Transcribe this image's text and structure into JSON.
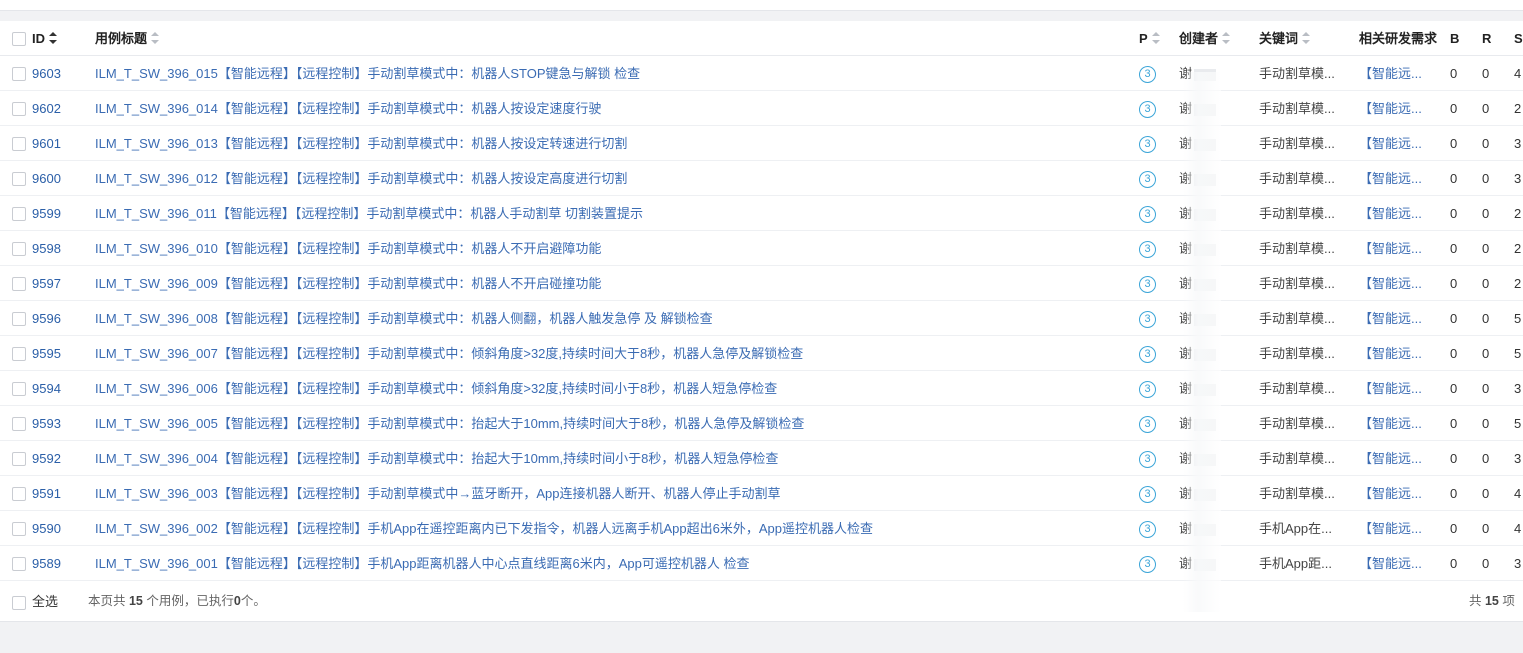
{
  "header": {
    "id": "ID",
    "title": "用例标题",
    "priority": "P",
    "creator": "创建者",
    "keyword": "关键词",
    "related": "相关研发需求",
    "b": "B",
    "r": "R",
    "s": "S"
  },
  "rows": [
    {
      "id": "9603",
      "title": "ILM_T_SW_396_015【智能远程】【远程控制】手动割草模式中：机器人STOP键急与解锁 检查",
      "p": "3",
      "creator": "谢",
      "keyword": "手动割草模...",
      "req": "【智能远...",
      "b": "0",
      "r": "0",
      "s": "4"
    },
    {
      "id": "9602",
      "title": "ILM_T_SW_396_014【智能远程】【远程控制】手动割草模式中：机器人按设定速度行驶",
      "p": "3",
      "creator": "谢",
      "keyword": "手动割草模...",
      "req": "【智能远...",
      "b": "0",
      "r": "0",
      "s": "2"
    },
    {
      "id": "9601",
      "title": "ILM_T_SW_396_013【智能远程】【远程控制】手动割草模式中：机器人按设定转速进行切割",
      "p": "3",
      "creator": "谢",
      "keyword": "手动割草模...",
      "req": "【智能远...",
      "b": "0",
      "r": "0",
      "s": "3"
    },
    {
      "id": "9600",
      "title": "ILM_T_SW_396_012【智能远程】【远程控制】手动割草模式中：机器人按设定高度进行切割",
      "p": "3",
      "creator": "谢",
      "keyword": "手动割草模...",
      "req": "【智能远...",
      "b": "0",
      "r": "0",
      "s": "3"
    },
    {
      "id": "9599",
      "title": "ILM_T_SW_396_011【智能远程】【远程控制】手动割草模式中：机器人手动割草 切割装置提示",
      "p": "3",
      "creator": "谢",
      "keyword": "手动割草模...",
      "req": "【智能远...",
      "b": "0",
      "r": "0",
      "s": "2"
    },
    {
      "id": "9598",
      "title": "ILM_T_SW_396_010【智能远程】【远程控制】手动割草模式中：机器人不开启避障功能",
      "p": "3",
      "creator": "谢",
      "keyword": "手动割草模...",
      "req": "【智能远...",
      "b": "0",
      "r": "0",
      "s": "2"
    },
    {
      "id": "9597",
      "title": "ILM_T_SW_396_009【智能远程】【远程控制】手动割草模式中：机器人不开启碰撞功能",
      "p": "3",
      "creator": "谢",
      "keyword": "手动割草模...",
      "req": "【智能远...",
      "b": "0",
      "r": "0",
      "s": "2"
    },
    {
      "id": "9596",
      "title": "ILM_T_SW_396_008【智能远程】【远程控制】手动割草模式中：机器人侧翻，机器人触发急停 及 解锁检查",
      "p": "3",
      "creator": "谢",
      "keyword": "手动割草模...",
      "req": "【智能远...",
      "b": "0",
      "r": "0",
      "s": "5"
    },
    {
      "id": "9595",
      "title": "ILM_T_SW_396_007【智能远程】【远程控制】手动割草模式中：倾斜角度>32度,持续时间大于8秒，机器人急停及解锁检查",
      "p": "3",
      "creator": "谢",
      "keyword": "手动割草模...",
      "req": "【智能远...",
      "b": "0",
      "r": "0",
      "s": "5"
    },
    {
      "id": "9594",
      "title": "ILM_T_SW_396_006【智能远程】【远程控制】手动割草模式中：倾斜角度>32度,持续时间小于8秒，机器人短急停检查",
      "p": "3",
      "creator": "谢",
      "keyword": "手动割草模...",
      "req": "【智能远...",
      "b": "0",
      "r": "0",
      "s": "3"
    },
    {
      "id": "9593",
      "title": "ILM_T_SW_396_005【智能远程】【远程控制】手动割草模式中：抬起大于10mm,持续时间大于8秒，机器人急停及解锁检查",
      "p": "3",
      "creator": "谢",
      "keyword": "手动割草模...",
      "req": "【智能远...",
      "b": "0",
      "r": "0",
      "s": "5"
    },
    {
      "id": "9592",
      "title": "ILM_T_SW_396_004【智能远程】【远程控制】手动割草模式中：抬起大于10mm,持续时间小于8秒，机器人短急停检查",
      "p": "3",
      "creator": "谢",
      "keyword": "手动割草模...",
      "req": "【智能远...",
      "b": "0",
      "r": "0",
      "s": "3"
    },
    {
      "id": "9591",
      "title": "ILM_T_SW_396_003【智能远程】【远程控制】手动割草模式中→蓝牙断开，App连接机器人断开、机器人停止手动割草",
      "p": "3",
      "creator": "谢",
      "keyword": "手动割草模...",
      "req": "【智能远...",
      "b": "0",
      "r": "0",
      "s": "4"
    },
    {
      "id": "9590",
      "title": "ILM_T_SW_396_002【智能远程】【远程控制】手机App在遥控距离内已下发指令，机器人远离手机App超出6米外，App遥控机器人检查",
      "p": "3",
      "creator": "谢",
      "keyword": "手机App在...",
      "req": "【智能远...",
      "b": "0",
      "r": "0",
      "s": "4"
    },
    {
      "id": "9589",
      "title": "ILM_T_SW_396_001【智能远程】【远程控制】手机App距离机器人中心点直线距离6米内，App可遥控机器人 检查",
      "p": "3",
      "creator": "谢",
      "keyword": "手机App距...",
      "req": "【智能远...",
      "b": "0",
      "r": "0",
      "s": "3"
    }
  ],
  "footer": {
    "select_all": "全选",
    "summary_prefix": "本页共 ",
    "summary_count": "15",
    "summary_mid": " 个用例，已执行",
    "summary_exec": "0",
    "summary_suffix": "个。",
    "total_prefix": "共 ",
    "total_count": "15",
    "total_suffix": " 项"
  }
}
